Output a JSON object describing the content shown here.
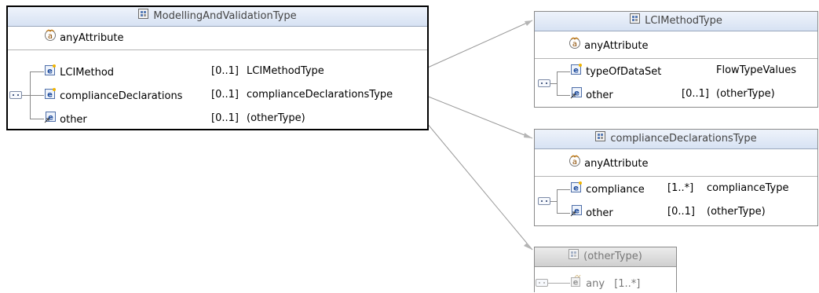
{
  "main": {
    "title": "ModellingAndValidationType",
    "any_attribute": "anyAttribute",
    "rows": [
      {
        "name": "LCIMethod",
        "occ": "[0..1]",
        "type": "LCIMethodType"
      },
      {
        "name": "complianceDeclarations",
        "occ": "[0..1]",
        "type": "complianceDeclarationsType"
      },
      {
        "name": "other",
        "occ": "[0..1]",
        "type": "(otherType)"
      }
    ]
  },
  "lci": {
    "title": "LCIMethodType",
    "any_attribute": "anyAttribute",
    "rows": [
      {
        "name": "typeOfDataSet",
        "occ": "",
        "type": "FlowTypeValues"
      },
      {
        "name": "other",
        "occ": "[0..1]",
        "type": "(otherType)"
      }
    ]
  },
  "compliance": {
    "title": "complianceDeclarationsType",
    "any_attribute": "anyAttribute",
    "rows": [
      {
        "name": "compliance",
        "occ": "[1..*]",
        "type": "complianceType"
      },
      {
        "name": "other",
        "occ": "[0..1]",
        "type": "(otherType)"
      }
    ]
  },
  "other_type": {
    "title": "(otherType)",
    "rows": [
      {
        "name": "any",
        "occ": "[1..*]"
      }
    ]
  },
  "icons": {
    "type_header": "complex-type-icon",
    "any_attribute": "any-attribute-icon",
    "element": "element-icon",
    "element_ref": "element-reference-icon",
    "any": "any-element-icon",
    "sequence": "sequence-compositor-icon"
  }
}
